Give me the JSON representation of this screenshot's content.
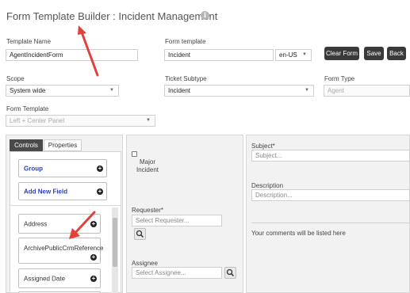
{
  "header": {
    "title": "Form Template Builder : Incident Management",
    "info_icon_glyph": "i"
  },
  "fields": {
    "template_name": {
      "label": "Template Name",
      "value": "AgentIncidentForm"
    },
    "form_template": {
      "label": "Form template",
      "value": "Incident",
      "locale": "en-US"
    },
    "scope": {
      "label": "Scope",
      "value": "System wide"
    },
    "ticket_subtype": {
      "label": "Ticket Subtype",
      "value": "Incident"
    },
    "form_type": {
      "label": "Form Type",
      "value": "Agent"
    },
    "form_template_layout": {
      "label": "Form Template",
      "value": "Left + Center Panel"
    }
  },
  "buttons": {
    "clear_form": "Clear Form",
    "save": "Save",
    "back": "Back"
  },
  "left_panel": {
    "tabs": [
      {
        "label": "Controls",
        "active": true
      },
      {
        "label": "Properties",
        "active": false
      }
    ],
    "top_controls": [
      {
        "label": "Group"
      },
      {
        "label": "Add New Field"
      }
    ],
    "field_controls": [
      {
        "label": "Address"
      },
      {
        "label": "ArchivePublicCrmReference"
      },
      {
        "label": "Assigned Date"
      }
    ]
  },
  "middle_panel": {
    "major_incident_label": "Major Incident",
    "requester": {
      "label": "Requester*",
      "placeholder": "Select Requester..."
    },
    "assignee": {
      "label": "Assignee",
      "placeholder": "Select Assignee..."
    }
  },
  "right_panel": {
    "subject": {
      "label": "Subject*",
      "placeholder": "Subject..."
    },
    "description": {
      "label": "Description",
      "placeholder": "Description..."
    },
    "comments_text": "Your comments will be listed here"
  },
  "icons": {
    "plus": "+",
    "caret": "▼",
    "search": "search-icon"
  },
  "colors": {
    "accent_arrow": "#e0423a",
    "button_dark": "#3a3a3a",
    "link_blue": "#2c3fb5"
  }
}
